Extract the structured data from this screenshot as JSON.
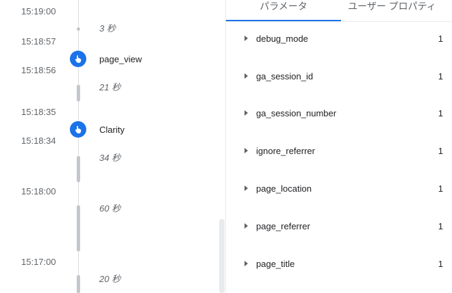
{
  "timeline": {
    "times": [
      "15:19:00",
      "15:18:57",
      "15:18:56",
      "15:18:35",
      "15:18:34",
      "15:18:00",
      "15:17:00"
    ],
    "durations": [
      "3 秒",
      "21 秒",
      "34 秒",
      "60 秒",
      "20 秒"
    ],
    "events": [
      {
        "name": "page_view",
        "icon": "hand-pointer-icon"
      },
      {
        "name": "Clarity",
        "icon": "hand-pointer-icon"
      }
    ]
  },
  "details": {
    "tabs": [
      {
        "label": "パラメータ",
        "active": true
      },
      {
        "label": "ユーザー プロパティ",
        "active": false
      }
    ],
    "params": [
      {
        "name": "debug_mode",
        "value": "1"
      },
      {
        "name": "ga_session_id",
        "value": "1"
      },
      {
        "name": "ga_session_number",
        "value": "1"
      },
      {
        "name": "ignore_referrer",
        "value": "1"
      },
      {
        "name": "page_location",
        "value": "1"
      },
      {
        "name": "page_referrer",
        "value": "1"
      },
      {
        "name": "page_title",
        "value": "1"
      }
    ]
  },
  "colors": {
    "accent": "#1a73e8",
    "muted": "#5f6368",
    "timeline_bar": "#c4c7cb"
  }
}
